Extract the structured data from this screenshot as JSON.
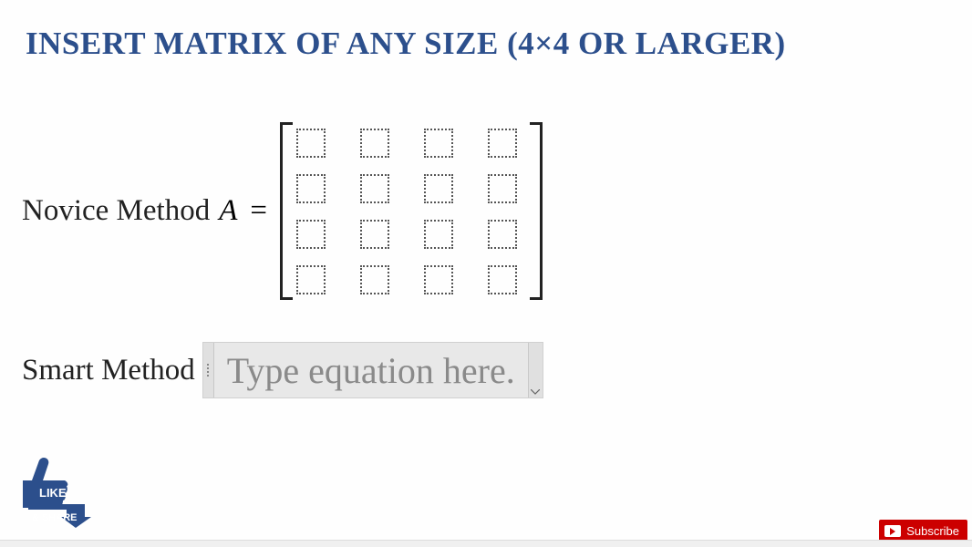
{
  "header": {
    "title": "INSERT MATRIX OF ANY SIZE (4×4 OR LARGER)"
  },
  "novice": {
    "label": "Novice Method",
    "variable": "A",
    "operator": "=",
    "matrix": {
      "rows": 4,
      "cols": 4
    }
  },
  "smart": {
    "label": "Smart Method",
    "placeholder": "Type equation here."
  },
  "like_share": {
    "like_text": "LIKE",
    "share_text": "& SHARE"
  },
  "subscribe": {
    "label": "Subscribe"
  }
}
